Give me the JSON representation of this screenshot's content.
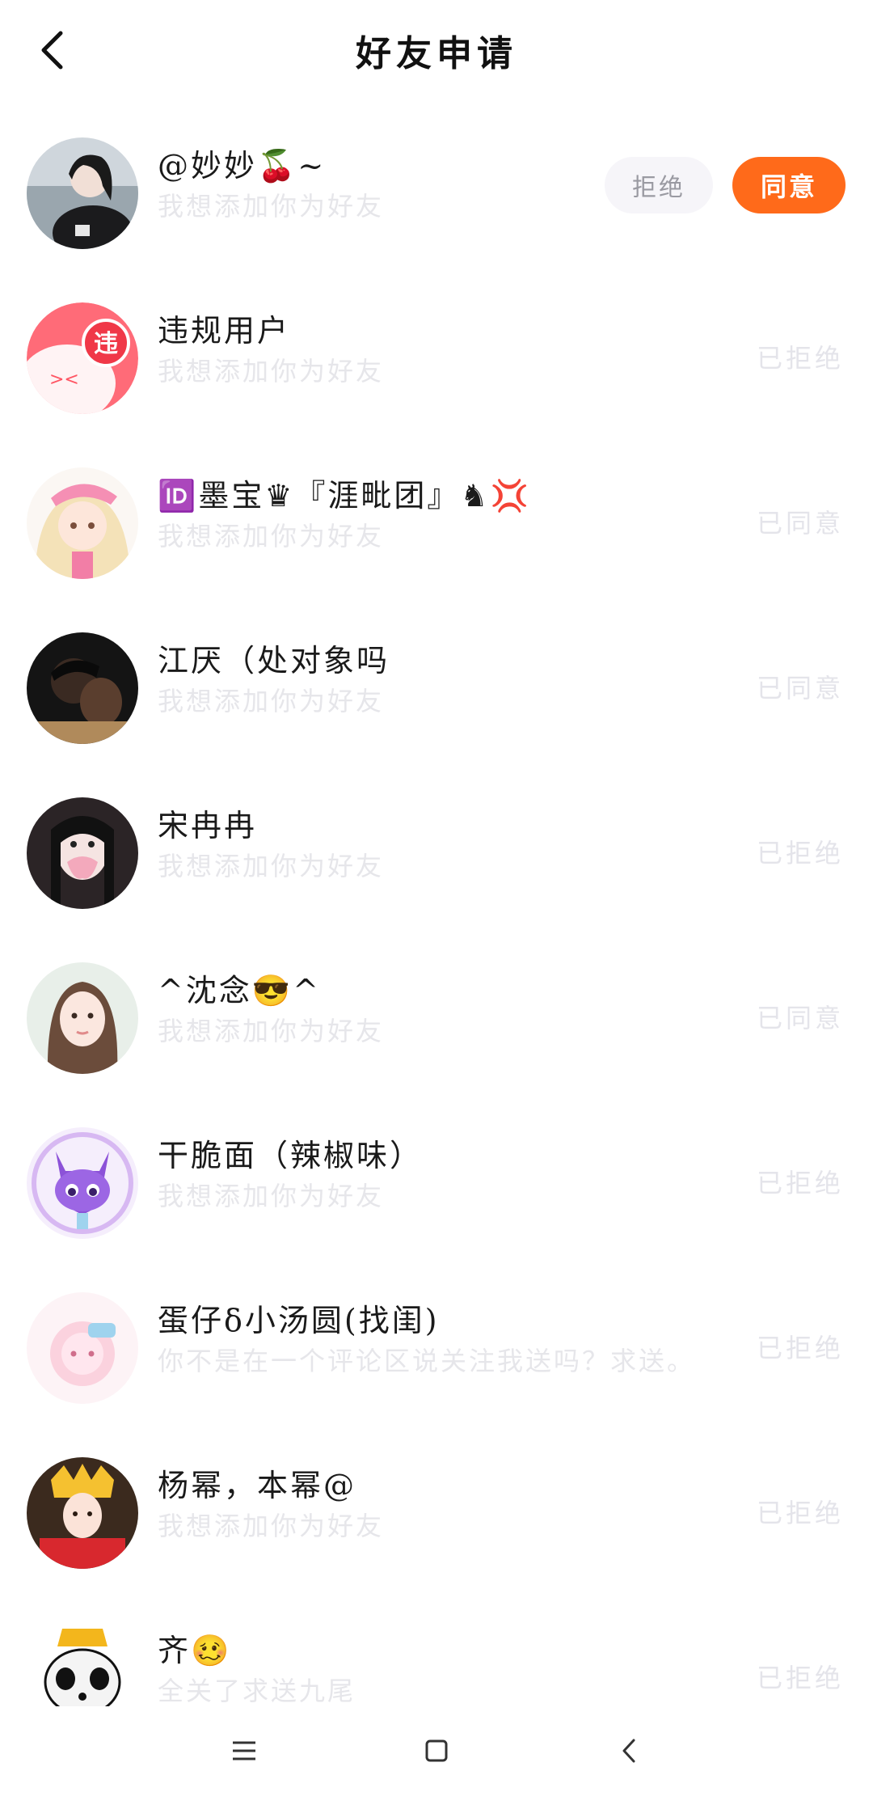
{
  "header": {
    "title": "好友申请",
    "back_icon": "chevron-left-icon"
  },
  "first_request": {
    "reject_label": "拒绝",
    "accept_label": "同意",
    "accept_color": "#ff6a1a"
  },
  "requests": [
    {
      "name": "@妙妙🍒~",
      "message": "我想添加你为好友",
      "status": ""
    },
    {
      "name": "违规用户",
      "message": "我想添加你为好友",
      "status": "已拒绝"
    },
    {
      "name": "🆔墨宝♛『涯毗团』♞💢",
      "message": "我想添加你为好友",
      "status": "已同意"
    },
    {
      "name": "江厌（处对象吗",
      "message": "我想添加你为好友",
      "status": "已同意"
    },
    {
      "name": "宋冉冉",
      "message": "我想添加你为好友",
      "status": "已拒绝"
    },
    {
      "name": "^沈念😎^",
      "message": "我想添加你为好友",
      "status": "已同意"
    },
    {
      "name": "干脆面（辣椒味）",
      "message": "我想添加你为好友",
      "status": "已拒绝"
    },
    {
      "name": "蛋仔δ小汤圆(找闺)",
      "message": "你不是在一个评论区说关注我送吗？求送。",
      "status": "已拒绝"
    },
    {
      "name": "杨幂，本幂@",
      "message": "我想添加你为好友",
      "status": "已拒绝"
    },
    {
      "name": "齐🥴",
      "message": "全关了求送九尾",
      "status": "已拒绝"
    }
  ],
  "violation_badge": "违",
  "navbar": {
    "menu_icon": "menu-icon",
    "home_icon": "home-square-icon",
    "back_icon": "back-triangle-icon"
  }
}
